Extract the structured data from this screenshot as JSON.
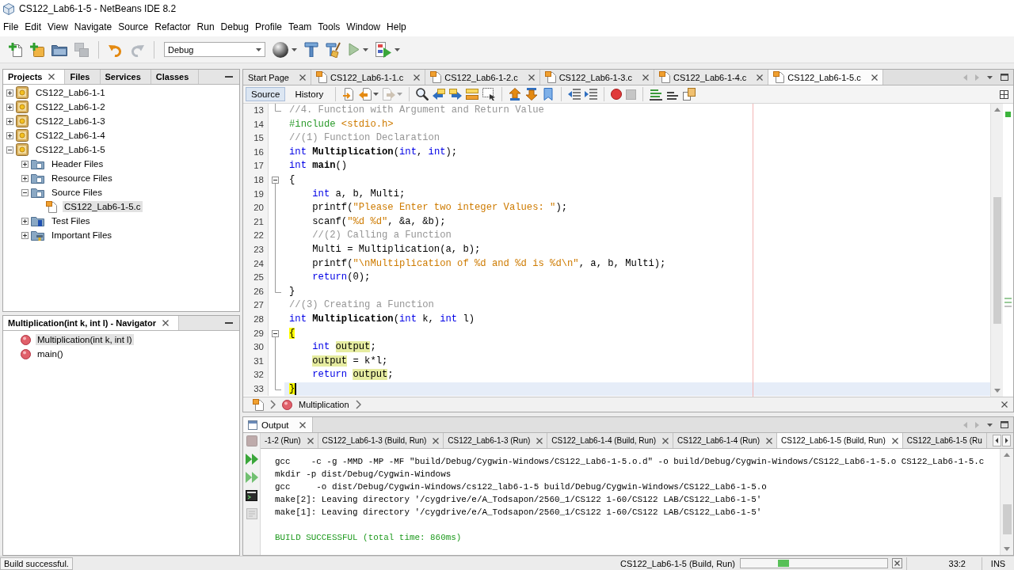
{
  "window": {
    "title": "CS122_Lab6-1-5 - NetBeans IDE 8.2"
  },
  "menu": [
    "File",
    "Edit",
    "View",
    "Navigate",
    "Source",
    "Refactor",
    "Run",
    "Debug",
    "Profile",
    "Team",
    "Tools",
    "Window",
    "Help"
  ],
  "toolbar": {
    "buttons": [
      {
        "kind": "new-file",
        "disabled": false
      },
      {
        "kind": "new-project",
        "disabled": false
      },
      {
        "kind": "open-project",
        "disabled": false
      },
      {
        "kind": "close-project",
        "disabled": true
      },
      {
        "kind": "separator"
      },
      {
        "kind": "undo",
        "disabled": false
      },
      {
        "kind": "redo",
        "disabled": true
      },
      {
        "kind": "separator"
      },
      {
        "kind": "configuration",
        "value": "Debug"
      },
      {
        "kind": "browser",
        "disabled": false
      },
      {
        "kind": "build",
        "disabled": false
      },
      {
        "kind": "clean-build",
        "disabled": false
      },
      {
        "kind": "run",
        "disabled": false
      },
      {
        "kind": "debug",
        "disabled": false
      }
    ]
  },
  "projects": {
    "tabs": [
      {
        "label": "Projects",
        "selected": true
      },
      {
        "label": "Files",
        "selected": false
      },
      {
        "label": "Services",
        "selected": false
      },
      {
        "label": "Classes",
        "selected": false
      }
    ],
    "tree": [
      {
        "label": "CS122_Lab6-1-1",
        "kind": "project",
        "expanded": false,
        "selected": false
      },
      {
        "label": "CS122_Lab6-1-2",
        "kind": "project",
        "expanded": false,
        "selected": false
      },
      {
        "label": "CS122_Lab6-1-3",
        "kind": "project",
        "expanded": false,
        "selected": false
      },
      {
        "label": "CS122_Lab6-1-4",
        "kind": "project",
        "expanded": false,
        "selected": false
      },
      {
        "label": "CS122_Lab6-1-5",
        "kind": "project",
        "expanded": true,
        "selected": false,
        "children": [
          {
            "label": "Header Files",
            "kind": "folder",
            "expanded": false,
            "selected": false
          },
          {
            "label": "Resource Files",
            "kind": "folder",
            "expanded": false,
            "selected": false
          },
          {
            "label": "Source Files",
            "kind": "folder",
            "expanded": true,
            "selected": false,
            "children": [
              {
                "label": "CS122_Lab6-1-5.c",
                "kind": "c-file",
                "selected": true
              }
            ]
          },
          {
            "label": "Test Files",
            "kind": "test-folder",
            "expanded": false,
            "selected": false
          },
          {
            "label": "Important Files",
            "kind": "important-folder",
            "expanded": false,
            "selected": false
          }
        ]
      }
    ]
  },
  "navigator": {
    "title": "Multiplication(int k, int l) - Navigator",
    "items": [
      {
        "label": "Multiplication(int k, int l)",
        "selected": true
      },
      {
        "label": "main()",
        "selected": false
      }
    ]
  },
  "editor": {
    "tabs": [
      {
        "label": "Start Page",
        "kind": "page",
        "selected": false
      },
      {
        "label": "CS122_Lab6-1-1.c",
        "kind": "source",
        "selected": false
      },
      {
        "label": "CS122_Lab6-1-2.c",
        "kind": "source",
        "selected": false
      },
      {
        "label": "CS122_Lab6-1-3.c",
        "kind": "source",
        "selected": false
      },
      {
        "label": "CS122_Lab6-1-4.c",
        "kind": "source",
        "selected": false
      },
      {
        "label": "CS122_Lab6-1-5.c",
        "kind": "source",
        "selected": true
      }
    ],
    "views": [
      {
        "label": "Source",
        "selected": true
      },
      {
        "label": "History",
        "selected": false
      }
    ],
    "toolbar": [
      {
        "kind": "separator"
      },
      {
        "kind": "last-edit",
        "disabled": false
      },
      {
        "kind": "back",
        "disabled": false
      },
      {
        "kind": "forward",
        "disabled": true
      },
      {
        "kind": "separator"
      },
      {
        "kind": "find",
        "disabled": false
      },
      {
        "kind": "find-previous",
        "disabled": false
      },
      {
        "kind": "find-next",
        "disabled": false
      },
      {
        "kind": "toggle-highlight",
        "disabled": false
      },
      {
        "kind": "find-selection",
        "disabled": false
      },
      {
        "kind": "separator"
      },
      {
        "kind": "previous-bookmark",
        "disabled": false
      },
      {
        "kind": "next-bookmark",
        "disabled": false
      },
      {
        "kind": "toggle-bookmark",
        "disabled": false
      },
      {
        "kind": "separator"
      },
      {
        "kind": "shift-left",
        "disabled": false
      },
      {
        "kind": "shift-right",
        "disabled": false
      },
      {
        "kind": "separator"
      },
      {
        "kind": "record-macro",
        "disabled": false
      },
      {
        "kind": "stop-macro",
        "disabled": true
      },
      {
        "kind": "separator"
      },
      {
        "kind": "comment",
        "disabled": false
      },
      {
        "kind": "uncomment",
        "disabled": false
      },
      {
        "kind": "run-file",
        "disabled": false
      }
    ],
    "lines": [
      {
        "number": "13",
        "kind": "closer",
        "current": false,
        "tokens": [
          {
            "kind": "comment",
            "text": "//4. Function with Argument and Return Value"
          }
        ]
      },
      {
        "number": "14",
        "kind": "plain",
        "current": false,
        "tokens": [
          {
            "kind": "directive",
            "text": "#include"
          },
          {
            "kind": "string",
            "text": " <stdio.h>"
          }
        ]
      },
      {
        "number": "15",
        "kind": "plain",
        "current": false,
        "tokens": [
          {
            "kind": "comment",
            "text": "//(1) Function Declaration"
          }
        ]
      },
      {
        "number": "16",
        "kind": "plain",
        "current": false,
        "tokens": [
          {
            "kind": "keyword",
            "text": "int"
          },
          {
            "kind": "declaration",
            "text": " Multiplication"
          },
          {
            "kind": "plain",
            "text": "("
          },
          {
            "kind": "keyword",
            "text": "int"
          },
          {
            "kind": "plain",
            "text": ", "
          },
          {
            "kind": "keyword",
            "text": "int"
          },
          {
            "kind": "plain",
            "text": ");"
          }
        ]
      },
      {
        "number": "17",
        "kind": "plain",
        "current": false,
        "tokens": [
          {
            "kind": "keyword",
            "text": "int"
          },
          {
            "kind": "declaration",
            "text": " main"
          },
          {
            "kind": "plain",
            "text": "()"
          }
        ]
      },
      {
        "number": "18",
        "kind": "opener",
        "current": false,
        "tokens": [
          {
            "kind": "plain",
            "text": "{"
          }
        ]
      },
      {
        "number": "19",
        "kind": "body",
        "current": false,
        "tokens": [
          {
            "kind": "keyword",
            "text": "    int"
          },
          {
            "kind": "plain",
            "text": " a, b, Multi;"
          }
        ]
      },
      {
        "number": "20",
        "kind": "body",
        "current": false,
        "tokens": [
          {
            "kind": "plain",
            "text": "    printf("
          },
          {
            "kind": "string",
            "text": "\"Please Enter two integer Values: \""
          },
          {
            "kind": "plain",
            "text": ");"
          }
        ]
      },
      {
        "number": "21",
        "kind": "body",
        "current": false,
        "tokens": [
          {
            "kind": "plain",
            "text": "    scanf("
          },
          {
            "kind": "string",
            "text": "\"%d %d\""
          },
          {
            "kind": "plain",
            "text": ", &a, &b);"
          }
        ]
      },
      {
        "number": "22",
        "kind": "body",
        "current": false,
        "tokens": [
          {
            "kind": "comment",
            "text": "    //(2) Calling a Function"
          }
        ]
      },
      {
        "number": "23",
        "kind": "body",
        "current": false,
        "tokens": [
          {
            "kind": "plain",
            "text": "    Multi = Multiplication(a, b);"
          }
        ]
      },
      {
        "number": "24",
        "kind": "body",
        "current": false,
        "tokens": [
          {
            "kind": "plain",
            "text": "    printf("
          },
          {
            "kind": "string",
            "text": "\"\\nMultiplication of %d and %d is %d\\n\""
          },
          {
            "kind": "plain",
            "text": ", a, b, Multi);"
          }
        ]
      },
      {
        "number": "25",
        "kind": "body",
        "current": false,
        "tokens": [
          {
            "kind": "keyword",
            "text": "    return"
          },
          {
            "kind": "plain",
            "text": "(0);"
          }
        ]
      },
      {
        "number": "26",
        "kind": "closer",
        "current": false,
        "tokens": [
          {
            "kind": "plain",
            "text": "}"
          }
        ]
      },
      {
        "number": "27",
        "kind": "plain",
        "current": false,
        "tokens": [
          {
            "kind": "comment",
            "text": "//(3) Creating a Function"
          }
        ]
      },
      {
        "number": "28",
        "kind": "plain",
        "current": false,
        "tokens": [
          {
            "kind": "keyword",
            "text": "int"
          },
          {
            "kind": "declaration",
            "text": " Multiplication"
          },
          {
            "kind": "plain",
            "text": "("
          },
          {
            "kind": "keyword",
            "text": "int"
          },
          {
            "kind": "plain",
            "text": " k, "
          },
          {
            "kind": "keyword",
            "text": "int"
          },
          {
            "kind": "plain",
            "text": " l)"
          }
        ]
      },
      {
        "number": "29",
        "kind": "opener",
        "current": false,
        "tokens": [
          {
            "kind": "brace",
            "text": "{"
          }
        ]
      },
      {
        "number": "30",
        "kind": "body",
        "current": false,
        "tokens": [
          {
            "kind": "keyword",
            "text": "    int"
          },
          {
            "kind": "occurrence",
            "text": " output"
          },
          {
            "kind": "plain",
            "text": ";"
          }
        ]
      },
      {
        "number": "31",
        "kind": "body",
        "current": false,
        "tokens": [
          {
            "kind": "occurrence",
            "text": "    output"
          },
          {
            "kind": "plain",
            "text": " = k*l;"
          }
        ]
      },
      {
        "number": "32",
        "kind": "body",
        "current": false,
        "tokens": [
          {
            "kind": "keyword",
            "text": "    return"
          },
          {
            "kind": "occurrence",
            "text": " output"
          },
          {
            "kind": "plain",
            "text": ";"
          }
        ]
      },
      {
        "number": "33",
        "kind": "closer",
        "current": true,
        "tokens": [
          {
            "kind": "brace",
            "text": "}"
          }
        ]
      }
    ],
    "breadcrumb": [
      "Multiplication"
    ]
  },
  "output": {
    "title": "Output",
    "toolbar": [
      {
        "kind": "stop",
        "disabled": true
      },
      {
        "kind": "rerun",
        "disabled": false
      },
      {
        "kind": "rerun-args",
        "disabled": false
      },
      {
        "kind": "settings",
        "disabled": false
      },
      {
        "kind": "clear",
        "disabled": true
      }
    ],
    "tabs": [
      {
        "label": "-1-2 (Run)",
        "selected": false,
        "closable": true
      },
      {
        "label": "CS122_Lab6-1-3 (Build, Run)",
        "selected": false,
        "closable": true
      },
      {
        "label": "CS122_Lab6-1-3 (Run)",
        "selected": false,
        "closable": true
      },
      {
        "label": "CS122_Lab6-1-4 (Build, Run)",
        "selected": false,
        "closable": true
      },
      {
        "label": "CS122_Lab6-1-4 (Run)",
        "selected": false,
        "closable": true
      },
      {
        "label": "CS122_Lab6-1-5 (Build, Run)",
        "selected": true,
        "closable": true
      },
      {
        "label": "CS122_Lab6-1-5 (Ru",
        "selected": false,
        "closable": false
      }
    ],
    "lines": [
      {
        "kind": "plain",
        "text": "gcc    -c -g -MMD -MP -MF \"build/Debug/Cygwin-Windows/CS122_Lab6-1-5.o.d\" -o build/Debug/Cygwin-Windows/CS122_Lab6-1-5.o CS122_Lab6-1-5.c"
      },
      {
        "kind": "plain",
        "text": "mkdir -p dist/Debug/Cygwin-Windows"
      },
      {
        "kind": "plain",
        "text": "gcc     -o dist/Debug/Cygwin-Windows/cs122_lab6-1-5 build/Debug/Cygwin-Windows/CS122_Lab6-1-5.o"
      },
      {
        "kind": "plain",
        "text": "make[2]: Leaving directory '/cygdrive/e/A_Todsapon/2560_1/CS122 1-60/CS122 LAB/CS122_Lab6-1-5'"
      },
      {
        "kind": "plain",
        "text": "make[1]: Leaving directory '/cygdrive/e/A_Todsapon/2560_1/CS122 1-60/CS122 LAB/CS122_Lab6-1-5'"
      },
      {
        "kind": "success",
        "text": "BUILD SUCCESSFUL (total time: 860ms)"
      }
    ]
  },
  "status_bar": {
    "message": "Build successful.",
    "task": "CS122_Lab6-1-5 (Build, Run)",
    "progress": {
      "busy": true
    },
    "position": "33:2",
    "mode": "INS"
  }
}
